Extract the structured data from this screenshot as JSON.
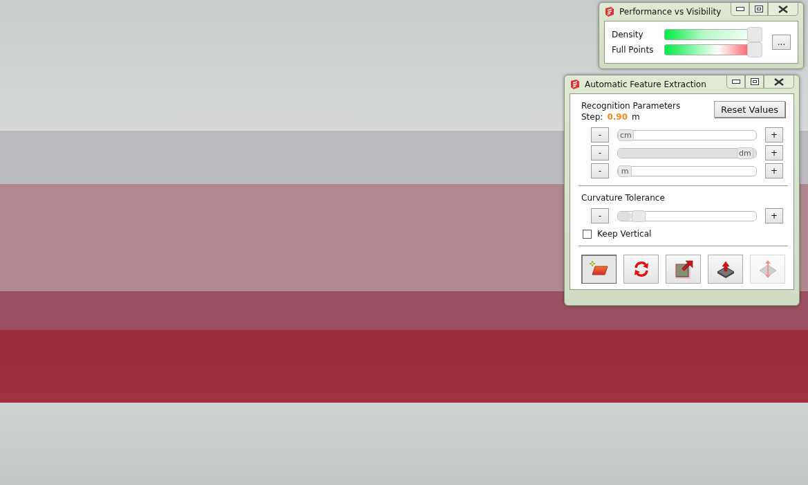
{
  "performance_window": {
    "title": "Performance vs Visibility",
    "sliders": [
      {
        "label": "Density",
        "kind": "fade",
        "level": 1
      },
      {
        "label": "Full Points",
        "kind": "fade-to-red",
        "level": 1
      }
    ],
    "more_button": "..."
  },
  "extraction_window": {
    "title": "Automatic Feature Extraction",
    "section_title": "Recognition Parameters",
    "reset_button": "Reset Values",
    "step_label": "Step:",
    "step_value": "0.90",
    "step_unit": "m",
    "step_sliders": [
      {
        "minus": "-",
        "thumb": "cm",
        "level": 0,
        "plus": "+"
      },
      {
        "minus": "-",
        "thumb": "dm",
        "level": 1,
        "plus": "+"
      },
      {
        "minus": "-",
        "thumb": "m",
        "level": 0,
        "plus": "+"
      }
    ],
    "curvature_title": "Curvature Tolerance",
    "curvature_slider": {
      "minus": "-",
      "level": 0.1,
      "plus": "+"
    },
    "keep_vertical": {
      "label": "Keep Vertical",
      "checked": false
    },
    "tools": [
      {
        "kind": "plane",
        "selected": true,
        "disabled": false
      },
      {
        "kind": "refresh",
        "selected": false,
        "disabled": false
      },
      {
        "kind": "extrude",
        "selected": false,
        "disabled": false
      },
      {
        "kind": "push",
        "selected": false,
        "disabled": false
      },
      {
        "kind": "surface",
        "selected": false,
        "disabled": true
      }
    ]
  }
}
